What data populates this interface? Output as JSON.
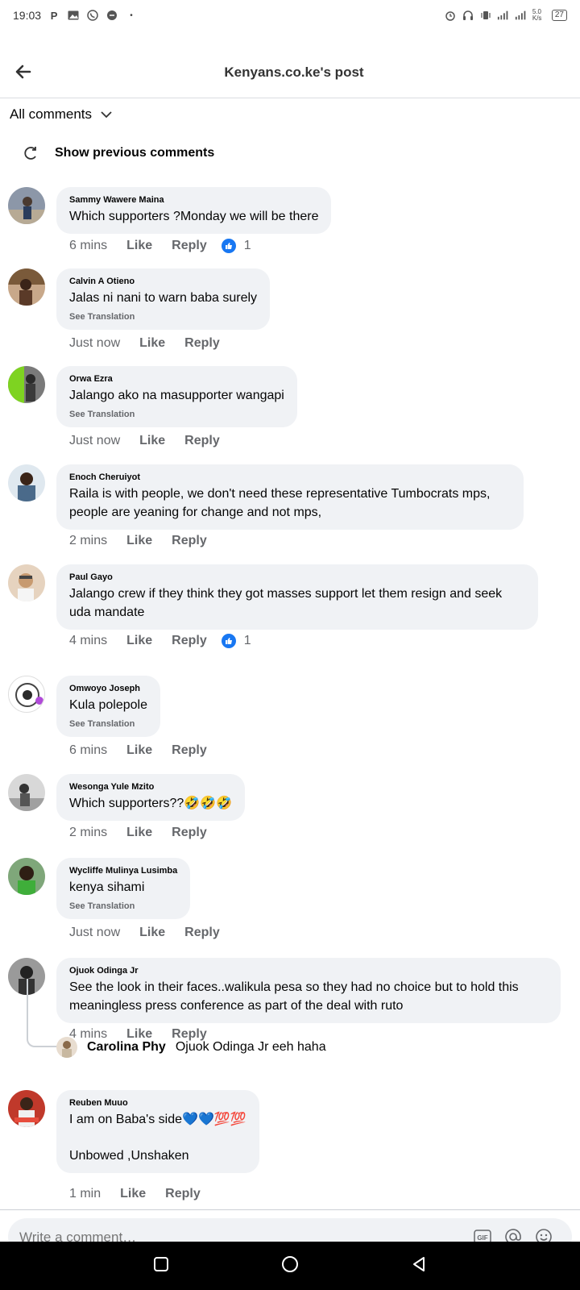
{
  "status": {
    "time": "19:03",
    "speed": "5.0 K/s",
    "battery": "27"
  },
  "header": {
    "title": "Kenyans.co.ke's post"
  },
  "filter": {
    "label": "All comments"
  },
  "prev": {
    "label": "Show previous comments"
  },
  "actions": {
    "like": "Like",
    "reply": "Reply",
    "see_translation": "See Translation"
  },
  "comments": [
    {
      "author": "Sammy Wawere Maina",
      "text": "Which supporters ?Monday we will be there",
      "time": "6 mins",
      "reactions": "1"
    },
    {
      "author": "Calvin A Otieno",
      "text": "Jalas ni nani to warn baba surely",
      "time": "Just now"
    },
    {
      "author": "Orwa Ezra",
      "text": "Jalango ako na masupporter wangapi",
      "time": "Just now"
    },
    {
      "author": "Enoch Cheruiyot",
      "text": "Raila is with people,  we don't need these representative Tumbocrats mps, people are yeaning for change and not mps,",
      "time": "2 mins"
    },
    {
      "author": "Paul Gayo",
      "text": "Jalango crew if they think they got masses support let them resign and seek uda mandate",
      "time": "4 mins",
      "reactions": "1"
    },
    {
      "author": "Omwoyo Joseph",
      "text": "Kula polepole",
      "time": "6 mins"
    },
    {
      "author": "Wesonga Yule Mzito",
      "text": "Which supporters??🤣🤣🤣",
      "time": "2 mins"
    },
    {
      "author": "Wycliffe Mulinya Lusimba",
      "text": "kenya sihami",
      "time": "Just now"
    },
    {
      "author": "Ojuok Odinga Jr",
      "text": "See the look in their faces..walikula pesa so they had no choice but to hold this meaningless press conference as part of the deal with ruto",
      "time": "4 mins"
    },
    {
      "author": "Reuben Muuo",
      "text": "I am on Baba's side💙💙💯💯",
      "text2": "Unbowed ,Unshaken",
      "time": "1 min"
    }
  ],
  "reply_preview": {
    "author": "Carolina Phy",
    "text": "Ojuok Odinga Jr eeh haha"
  },
  "compose": {
    "placeholder": "Write a comment…"
  }
}
